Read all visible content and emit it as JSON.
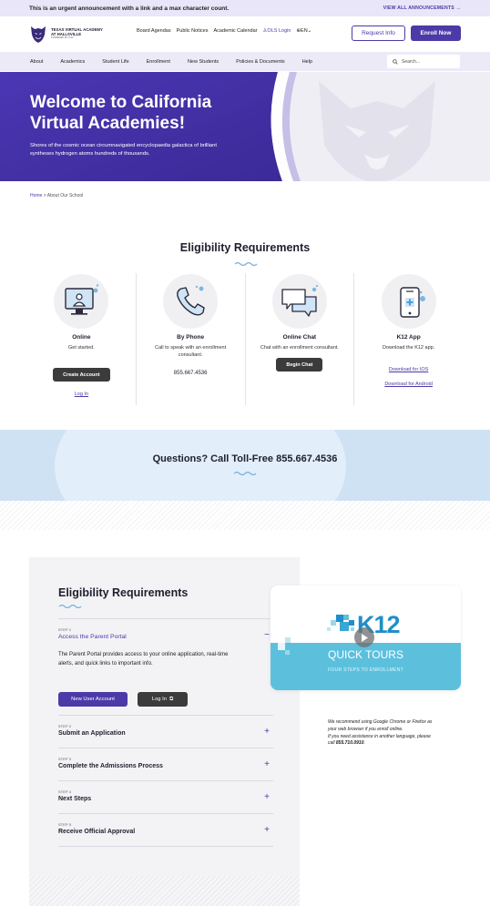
{
  "announcement": {
    "message": "This is an urgent announcement with a link and a max character count.",
    "link": "VIEW ALL ANNOUNCEMENTS"
  },
  "header": {
    "logo": {
      "line1": "TEXAS VIRTUAL ACADEMY",
      "line2": "AT HALLSVILLE",
      "line3": "POWERED BY K12"
    },
    "utility_links": [
      "Board Agendas",
      "Public Notices",
      "Academic Calendar"
    ],
    "ols_login": "OLS Login",
    "language": "EN",
    "request_info": "Request Info",
    "enroll_now": "Enroll Now"
  },
  "nav": {
    "items": [
      "About",
      "Academics",
      "Student Life",
      "Enrollment",
      "New Students",
      "Policies & Documents",
      "Help"
    ],
    "search_placeholder": "Search..."
  },
  "hero": {
    "title": "Welcome to California Virtual Academies!",
    "subtitle": "Shores of the cosmic ocean circumnavigated encyclopaedia galactica of brilliant syntheses hydrogen atoms hundreds of thousands."
  },
  "breadcrumb": {
    "home": "Home",
    "separator": ">",
    "current": "About Our School"
  },
  "eligibility": {
    "title": "Eligibility Requirements",
    "columns": [
      {
        "title": "Online",
        "desc": "Get started.",
        "button": "Create Account",
        "link": "Log In"
      },
      {
        "title": "By Phone",
        "desc": "Call to speak with an enrollment consultant.",
        "phone": "855.667.4536"
      },
      {
        "title": "Online Chat",
        "desc": "Chat with an enrollment consultant.",
        "button": "Begin Chat"
      },
      {
        "title": "K12 App",
        "desc": "Download the K12 app.",
        "link_ios": "Download for IOS",
        "link_android": "Download for Android"
      }
    ]
  },
  "questions": {
    "title": "Questions? Call Toll-Free 855.667.4536"
  },
  "steps": {
    "title": "Eligibility Requirements",
    "items": [
      {
        "num": "STEP 1",
        "name": "Access the Parent Portal",
        "toggle": "−",
        "body": "The Parent Portal provides access to your online application, real-time alerts, and quick links to important info.",
        "btn_new": "New User Account",
        "btn_login": "Log In"
      },
      {
        "num": "STEP 2",
        "name": "Submit an Application",
        "toggle": "+"
      },
      {
        "num": "STEP 3",
        "name": "Complete the Admissions Process",
        "toggle": "+"
      },
      {
        "num": "STEP 4",
        "name": "Next Steps",
        "toggle": "+"
      },
      {
        "num": "STEP 5",
        "name": "Receive Official Approval",
        "toggle": "+"
      }
    ]
  },
  "video": {
    "brand": "K12",
    "title": "QUICK TOURS",
    "subtitle": "FOUR STEPS TO ENROLLMENT"
  },
  "note": {
    "line1": "We recommend using Google Chrome or Firefox as your web browser if you enroll online.",
    "line2_prefix": "If you need assistance in another language, please call ",
    "phone": "855.710.0910",
    "line2_suffix": "."
  },
  "colors": {
    "brand": "#4b3aa7",
    "hero_purple": "#4a35b0",
    "cyan": "#5cc0dd",
    "band_blue": "#cfe2f3"
  }
}
